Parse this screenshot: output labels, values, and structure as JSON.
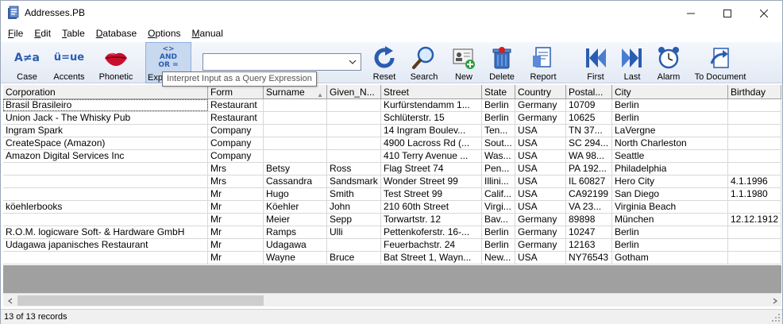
{
  "window": {
    "title": "Addresses.PB"
  },
  "menu": [
    {
      "key": "F",
      "rest": "ile"
    },
    {
      "key": "E",
      "rest": "dit"
    },
    {
      "key": "T",
      "rest": "able"
    },
    {
      "key": "D",
      "rest": "atabase"
    },
    {
      "key": "O",
      "rest": "ptions"
    },
    {
      "key": "M",
      "rest": "anual"
    }
  ],
  "toolbar": {
    "case": "Case",
    "accents": "Accents",
    "phonetic": "Phonetic",
    "expression": "Exp",
    "case_glyph": "A≠a",
    "accents_glyph": "ü=ue",
    "expr_glyph_top": "<>",
    "expr_glyph_mid": "AND",
    "expr_glyph_bot": "OR =",
    "reset": "Reset",
    "search": "Search",
    "new": "New",
    "delete": "Delete",
    "report": "Report",
    "first": "First",
    "last": "Last",
    "alarm": "Alarm",
    "to_document": "To Document",
    "query_value": "",
    "tooltip": "Interpret Input as a Query Expression"
  },
  "table": {
    "columns": [
      "Corporation",
      "Form",
      "Surname",
      "Given_N...",
      "Street",
      "State",
      "Country",
      "Postal...",
      "City",
      "Birthday"
    ],
    "rows": [
      [
        "Brasil Brasileiro",
        "Restaurant",
        "",
        "",
        "Kurfürstendamm 1...",
        "Berlin",
        "Germany",
        "10709",
        "Berlin",
        ""
      ],
      [
        "Union Jack - The Whisky Pub",
        "Restaurant",
        "",
        "",
        "Schlüterstr. 15",
        "Berlin",
        "Germany",
        "10625",
        "Berlin",
        ""
      ],
      [
        "Ingram Spark",
        "Company",
        "",
        "",
        "14 Ingram Boulev...",
        "Ten...",
        "USA",
        "TN 37...",
        "LaVergne",
        ""
      ],
      [
        "CreateSpace (Amazon)",
        "Company",
        "",
        "",
        "4900 Lacross Rd (...",
        "Sout...",
        "USA",
        "SC 294...",
        "North Charleston",
        ""
      ],
      [
        "Amazon Digital Services Inc",
        "Company",
        "",
        "",
        "410 Terry Avenue ...",
        "Was...",
        "USA",
        "WA 98...",
        "Seattle",
        ""
      ],
      [
        "",
        "Mrs",
        "Betsy",
        "Ross",
        "Flag Street 74",
        "Pen...",
        "USA",
        "PA 192...",
        "Philadelphia",
        ""
      ],
      [
        "",
        "Mrs",
        "Cassandra",
        "Sandsmark",
        "Wonder Street 99",
        "Illini...",
        "USA",
        "IL 60827",
        "Hero City",
        "4.1.1996"
      ],
      [
        "",
        "Mr",
        "Hugo",
        "Smith",
        "Test Street 99",
        "Calif...",
        "USA",
        "CA92199",
        "San Diego",
        "1.1.1980"
      ],
      [
        "köehlerbooks",
        "Mr",
        "Köehler",
        "John",
        "210 60th Street",
        "Virgi...",
        "USA",
        "VA 23...",
        "Virginia Beach",
        ""
      ],
      [
        "",
        "Mr",
        "Meier",
        "Sepp",
        "Torwartstr. 12",
        "Bav...",
        "Germany",
        "89898",
        "München",
        "12.12.1912"
      ],
      [
        "R.O.M. logicware Soft- & Hardware GmbH",
        "Mr",
        "Ramps",
        "Ulli",
        "Pettenkoferstr. 16-...",
        "Berlin",
        "Germany",
        "10247",
        "Berlin",
        ""
      ],
      [
        "Udagawa japanisches Restaurant",
        "Mr",
        "Udagawa",
        "",
        "Feuerbachstr. 24",
        "Berlin",
        "Germany",
        "12163",
        "Berlin",
        ""
      ],
      [
        "",
        "Mr",
        "Wayne",
        "Bruce",
        "Bat Street 1, Wayn...",
        "New...",
        "USA",
        "NY76543",
        "Gotham",
        ""
      ]
    ]
  },
  "status": {
    "text": "13 of 13 records"
  },
  "colors": {
    "toolbar_bg": "#e3eaf5",
    "grid_empty": "#a0a0a0",
    "icon_blue": "#2a5db0"
  }
}
